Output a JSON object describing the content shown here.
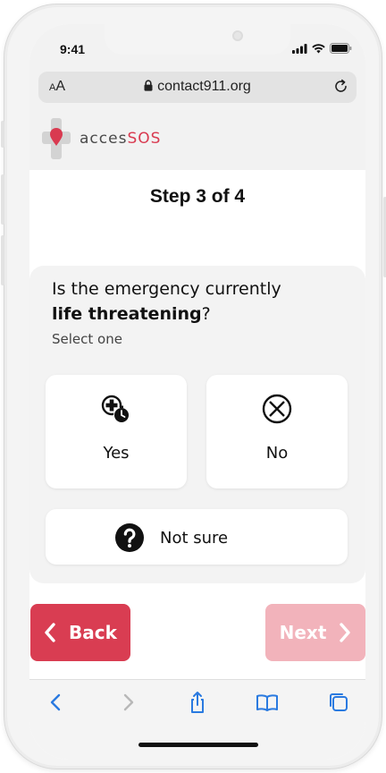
{
  "status_bar": {
    "time": "9:41"
  },
  "browser": {
    "text_size_label_large": "A",
    "text_size_label_small": "A",
    "url": "contact911.org"
  },
  "brand": {
    "name_prefix": "acces",
    "name_accent": "SOS",
    "accent_color": "#d93a50"
  },
  "step": {
    "title": "Step 3 of 4"
  },
  "question": {
    "text_regular": "Is the emergency currently",
    "text_bold": "life threatening",
    "text_end": "?",
    "hint": "Select one"
  },
  "options": {
    "yes": {
      "label": "Yes",
      "icon": "medical-clock-icon"
    },
    "no": {
      "label": "No",
      "icon": "x-circle-icon"
    },
    "unsure": {
      "label": "Not sure",
      "icon": "question-circle-icon"
    }
  },
  "actions": {
    "back_label": "Back",
    "next_label": "Next",
    "back_color": "#d93d52",
    "next_color": "#f2b3bb"
  },
  "toolbar": {
    "items": [
      "back-icon",
      "forward-icon",
      "share-icon",
      "bookmarks-icon",
      "tabs-icon"
    ]
  }
}
